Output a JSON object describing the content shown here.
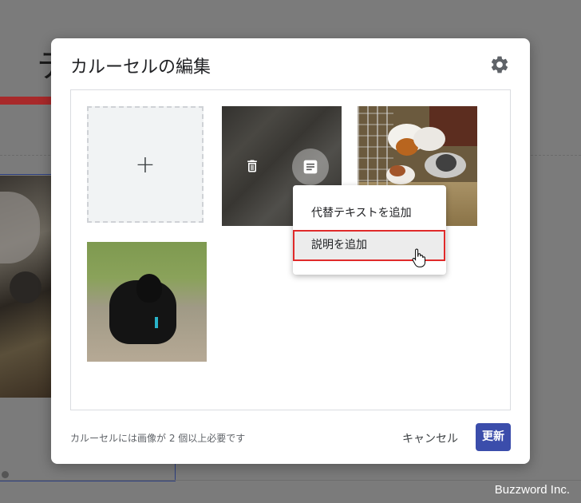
{
  "background": {
    "title_fragment": "テ"
  },
  "dialog": {
    "title": "カルーセルの編集",
    "settings_icon": "gear-icon",
    "add_tile_symbol": "+",
    "context_menu": {
      "items": [
        {
          "label": "代替テキストを追加"
        },
        {
          "label": "説明を追加"
        }
      ]
    },
    "footnote": "カルーセルには画像が 2 個以上必要です",
    "cancel_label": "キャンセル",
    "update_label": "更新"
  },
  "watermark": "Buzzword Inc."
}
